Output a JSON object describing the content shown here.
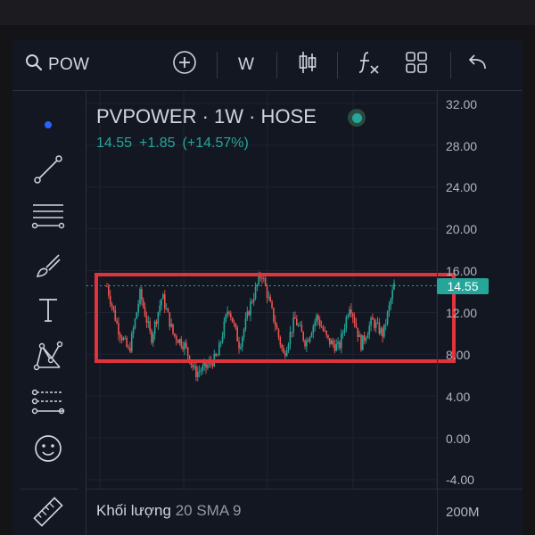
{
  "toolbar": {
    "symbol": "POW",
    "interval": "W"
  },
  "legend": {
    "title": "PVPOWER · 1W · HOSE",
    "price": "14.55",
    "change": "+1.85",
    "change_pct": "(+14.57%)"
  },
  "price_axis": [
    "32.00",
    "28.00",
    "24.00",
    "20.00",
    "16.00",
    "12.00",
    "8.00",
    "4.00",
    "0.00",
    "-4.00"
  ],
  "last_price_tag": "14.55",
  "volume_pane": {
    "label": "Khối lượng",
    "params": "20 SMA 9",
    "axis_value": "200M"
  },
  "colors": {
    "background": "#131722",
    "up": "#26a69a",
    "down": "#ef5350",
    "highlight_box": "#e0333c",
    "text": "#d1d4dc"
  },
  "icons": [
    "search-icon",
    "add-symbol-icon",
    "candles-icon",
    "indicators-icon",
    "layout-icon",
    "undo-icon",
    "crosshair-dot-icon",
    "trend-line-icon",
    "fib-lines-icon",
    "brush-icon",
    "text-icon",
    "pattern-icon",
    "forecast-icon",
    "emoji-icon",
    "ruler-icon"
  ],
  "chart_data": {
    "type": "candlestick",
    "title": "PVPOWER · 1W · HOSE",
    "ylim": [
      -4,
      32
    ],
    "y_ticks": [
      32,
      28,
      24,
      20,
      16,
      12,
      8,
      4,
      0,
      -4
    ],
    "last_value": 14.55,
    "close_path": [
      14.5,
      10.5,
      8.2,
      13.8,
      9.5,
      13.6,
      9.9,
      8.9,
      6.2,
      6.8,
      7.8,
      12.6,
      8.8,
      12.8,
      15.8,
      11.8,
      7.9,
      11.4,
      9.1,
      11.6,
      9.3,
      8.6,
      12.9,
      8.9,
      11.2,
      9.9,
      14.6
    ],
    "highlight_range": [
      7.6,
      15.6
    ]
  }
}
